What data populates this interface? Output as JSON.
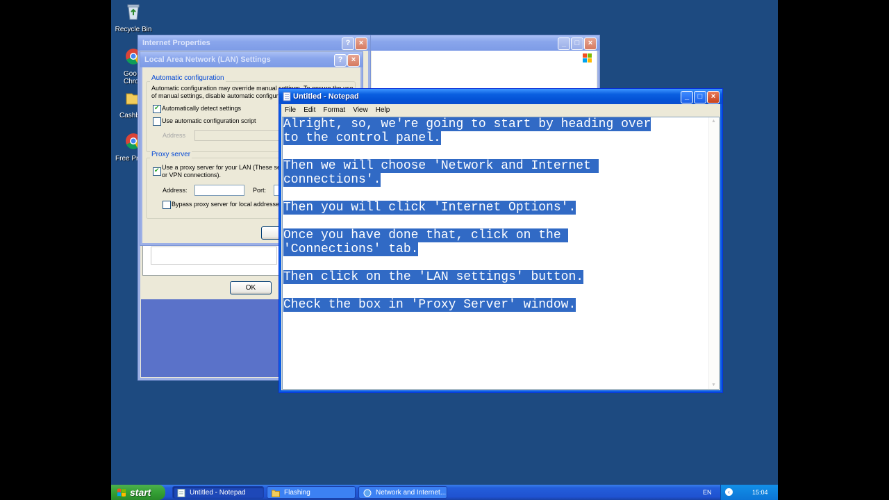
{
  "desktop": {
    "icons": [
      {
        "label": "Recycle Bin"
      },
      {
        "label": "Goo\nChro"
      },
      {
        "label": "Cashb"
      },
      {
        "label": "Free Pr"
      }
    ]
  },
  "internet_properties": {
    "title": "Internet Properties",
    "ok_label": "OK"
  },
  "bg_window": {
    "title": ""
  },
  "lan_dialog": {
    "title": "Local Area Network (LAN) Settings",
    "auto_config_label": "Automatic configuration",
    "auto_config_desc": "Automatic configuration may override manual settings. To ensure the use of manual settings, disable automatic configuration.",
    "auto_detect_label": "Automatically detect settings",
    "auto_detect_checked": true,
    "use_script_label": "Use automatic configuration script",
    "use_script_checked": false,
    "address_label": "Address",
    "proxy_server_label": "Proxy server",
    "use_proxy_label": "Use a proxy server for your LAN (These settings will not apply to dial-up or VPN connections).",
    "use_proxy_checked": true,
    "proxy_address_label": "Address:",
    "port_label": "Port:",
    "bypass_label": "Bypass proxy server for local addresses",
    "bypass_checked": false
  },
  "notepad": {
    "title": "Untitled - Notepad",
    "menu": [
      "File",
      "Edit",
      "Format",
      "View",
      "Help"
    ],
    "lines": [
      "Alright, so, we're going to start by heading over",
      "to the control panel.",
      "",
      "Then we will choose 'Network and Internet ",
      "connections'.",
      "",
      "Then you will click 'Internet Options'.",
      "",
      "Once you have done that, click on the ",
      "'Connections' tab.",
      "",
      "Then click on the 'LAN settings' button.",
      "",
      "Check the box in 'Proxy Server' window."
    ]
  },
  "taskbar": {
    "start_label": "start",
    "tasks": [
      {
        "label": "Untitled - Notepad"
      },
      {
        "label": "Flashing"
      },
      {
        "label": "Network and Internet..."
      }
    ],
    "lang": "EN",
    "clock": "15:04"
  },
  "colors": {
    "desktop": "#1d4a80",
    "selection": "#316ac5",
    "titlebar_active": "#0a5fe0"
  }
}
